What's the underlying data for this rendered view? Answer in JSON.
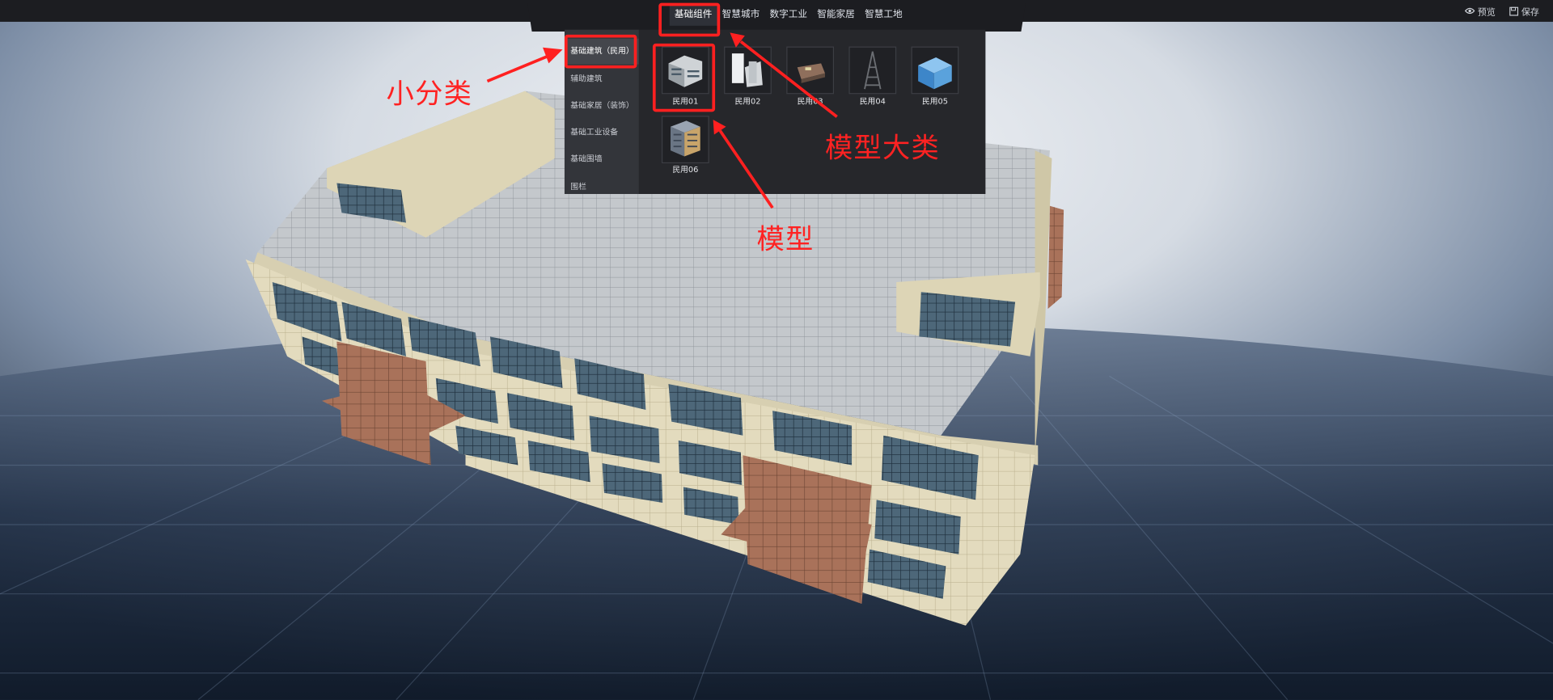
{
  "topbar": {
    "tabs": [
      {
        "label": "基础组件",
        "active": true
      },
      {
        "label": "智慧城市",
        "active": false
      },
      {
        "label": "数字工业",
        "active": false
      },
      {
        "label": "智能家居",
        "active": false
      },
      {
        "label": "智慧工地",
        "active": false
      }
    ],
    "actions": [
      {
        "label": "预览",
        "icon": "eye-icon"
      },
      {
        "label": "保存",
        "icon": "save-icon"
      }
    ]
  },
  "panel": {
    "subcategories": [
      {
        "label": "基础建筑（民用）",
        "active": true
      },
      {
        "label": "辅助建筑",
        "active": false
      },
      {
        "label": "基础家居（装饰）",
        "active": false
      },
      {
        "label": "基础工业设备",
        "active": false
      },
      {
        "label": "基础围墙",
        "active": false
      },
      {
        "label": "围栏",
        "active": false
      }
    ],
    "models": [
      {
        "label": "民用01",
        "icon": "office-building-thumbnail"
      },
      {
        "label": "民用02",
        "icon": "white-building-thumbnail"
      },
      {
        "label": "民用03",
        "icon": "low-building-thumbnail"
      },
      {
        "label": "民用04",
        "icon": "tower-thumbnail"
      },
      {
        "label": "民用05",
        "icon": "blue-building-thumbnail"
      },
      {
        "label": "民用06",
        "icon": "tall-building-thumbnail"
      }
    ]
  },
  "annotations": {
    "subcategory": "小分类",
    "category": "模型大类",
    "model": "模型"
  },
  "colors": {
    "annotation": "#ff2020",
    "topbar": "#1c1d21",
    "panel": "#26272b",
    "sidebar": "#33353a"
  }
}
